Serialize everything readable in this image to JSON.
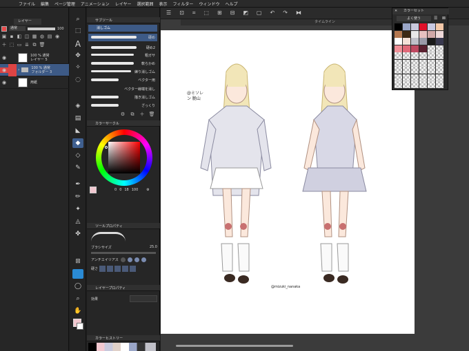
{
  "menubar": {
    "items": [
      "ファイル",
      "編集",
      "ページ管理",
      "アニメーション",
      "レイヤー",
      "選択範囲",
      "表示",
      "フィルター",
      "ウィンドウ",
      "ヘルプ"
    ]
  },
  "layers": {
    "tab": "レイヤー",
    "blend_mode": "通常",
    "opacity": "100",
    "rows": [
      {
        "line1": "100 % 通常",
        "line2": "レイヤー 5"
      },
      {
        "line1": "100 % 通常",
        "line2": "フォルダー 3"
      },
      {
        "line1": "",
        "line2": "用紙"
      }
    ]
  },
  "subtool": {
    "header": "サブツール",
    "group": "消しゴム",
    "brushes": [
      "硬め",
      "硬め2",
      "粗ガサ",
      "軟らかめ",
      "練り消しゴム",
      "ベクター用",
      "ベクター線端を消し",
      "描き消しゴム",
      "ざっくり"
    ]
  },
  "color_circle": {
    "header": "カラーサークル",
    "values": [
      "0",
      "0",
      "18",
      "100"
    ]
  },
  "tool_property": {
    "header": "ツールプロパティ",
    "brush_size_label": "ブラシサイズ",
    "brush_size": "25.0",
    "antialias_label": "アンチエイリアス",
    "hardness_label": "硬さ"
  },
  "layer_property": {
    "header": "レイヤープロパティ",
    "effect_label": "効果"
  },
  "color_history": {
    "header": "カラーヒストリー"
  },
  "timeline": {
    "label": "タイムライン"
  },
  "colorset": {
    "header": "カラーセット",
    "dropdown": "よく使う",
    "swatches": [
      "#000000",
      "#9aa6c8",
      "#c8c8dc",
      "#e0102a",
      "#c8c8e0",
      "#f4c8a8",
      "#b47850",
      "#3c2814",
      "#e8e8e8",
      "#e6c0c0",
      "#d0a8a8",
      "#eed8d8",
      "#ffffff",
      "#f4e0d8",
      "#c0c0c8",
      "#9a9aa8",
      "#1a1a1a",
      "#3a3a50",
      "#f09098",
      "#e06878",
      "#c04860",
      "#5a2030"
    ]
  },
  "canvas": {
    "annotation": "@ミソレン 脆山",
    "signature": "@mizuki_nanaka"
  },
  "accent": "#3d5a86"
}
